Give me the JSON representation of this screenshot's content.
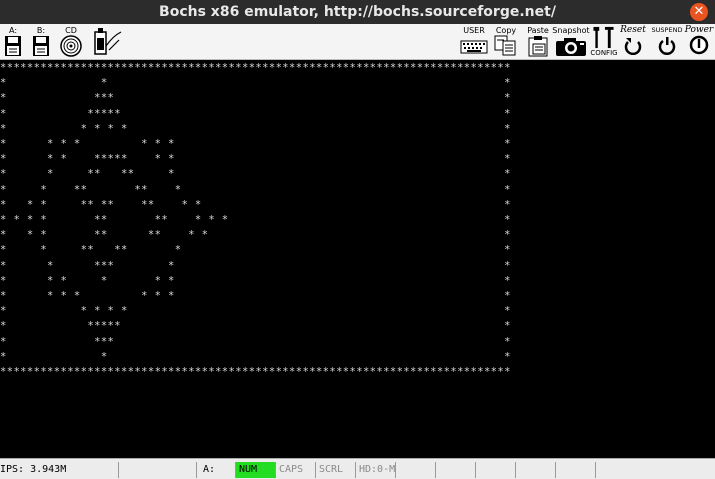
{
  "window": {
    "title": "Bochs x86 emulator, http://bochs.sourceforge.net/"
  },
  "toolbar": {
    "floppy_a_label": "A:",
    "floppy_b_label": "B:",
    "cdrom_label": "CD",
    "user_label": "USER",
    "copy_label": "Copy",
    "paste_label": "Paste",
    "snapshot_label": "Snapshot",
    "config_label": "CONFIG",
    "reset_label": "Reset",
    "suspend_label": "SUSPEND",
    "power_label": "Power"
  },
  "screen": {
    "text_lines": [
      "****************************************************************************",
      "*              *                                                           *",
      "*             ***                                                          *",
      "*            *****                                                         *",
      "*           * * * *                                                        *",
      "*      * * *         * * *                                                 *",
      "*      * *    *****    * *                                                 *",
      "*      *     **   **     *                                                 *",
      "*     *    **       **    *                                                *",
      "*   * *     ** **    **    * *                                             *",
      "* * * *       **       **    * * *                                         *",
      "*   * *       **      **    * *                                            *",
      "*     *     **   **       *                                                *",
      "*      *      ***        *                                                 *",
      "*      * *     *       * *                                                 *",
      "*      * * *         * * *                                                 *",
      "*           * * * *                                                        *",
      "*            *****                                                         *",
      "*             ***                                                          *",
      "*              *                                                           *",
      "****************************************************************************"
    ]
  },
  "statusbar": {
    "ips": "IPS: 3.943M",
    "floppy": "A:",
    "num": "NUM",
    "caps": "CAPS",
    "scrl": "SCRL",
    "hd": "HD:0-M"
  }
}
